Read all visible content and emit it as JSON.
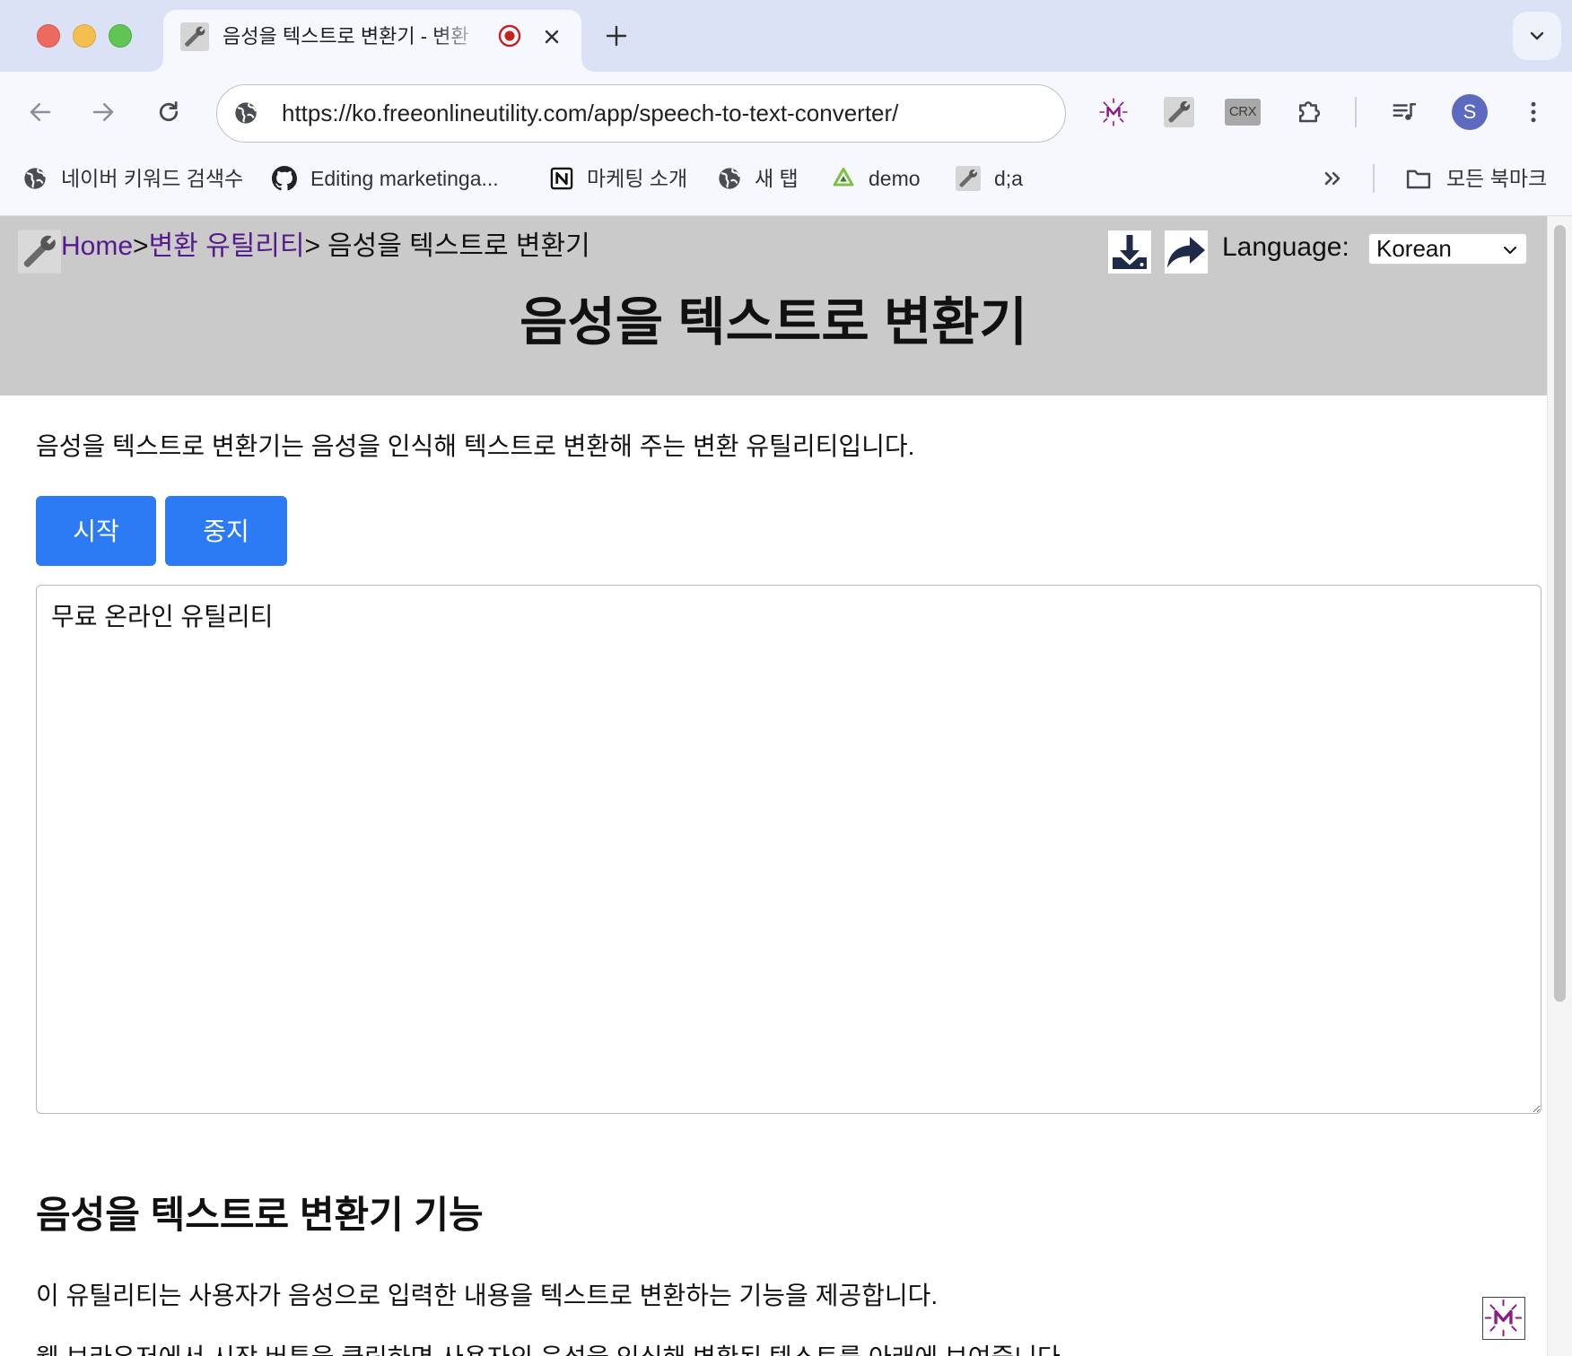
{
  "browser": {
    "tab": {
      "title": "음성을 텍스트로 변환기 - 변환",
      "favicon": "wrench-icon",
      "status_icon": "recording-icon"
    },
    "address_bar": {
      "url": "https://ko.freeonlineutility.com/app/speech-to-text-converter/",
      "site_icon": "globe-icon"
    },
    "extensions": [
      {
        "icon": "m-extension-icon",
        "logo_letter": "M"
      },
      {
        "icon": "wrench-extension-icon"
      },
      {
        "icon": "crx-extension-icon",
        "label": "CRX"
      },
      {
        "icon": "puzzle-icon"
      },
      {
        "icon": "media-control-icon"
      }
    ],
    "profile": {
      "initial": "S",
      "color": "#5c6bc0"
    },
    "bookmarks": [
      {
        "label": "네이버 키워드 검색수",
        "icon": "globe-icon"
      },
      {
        "label": "Editing marketinga...",
        "icon": "github-icon"
      },
      {
        "label": "마케팅 소개",
        "icon": "notion-icon"
      },
      {
        "label": "새 탭",
        "icon": "globe-icon"
      },
      {
        "label": "demo",
        "icon": "demo-icon"
      },
      {
        "label": "d;a",
        "icon": "wrench-icon"
      }
    ],
    "all_bookmarks": {
      "label": "모든 북마크",
      "icon": "folder-icon"
    }
  },
  "header": {
    "breadcrumb": {
      "home": "Home",
      "separator": ">",
      "category": "변환 유틸리티",
      "current": "음성을 텍스트로 변환기"
    },
    "actions": [
      {
        "icon": "download-icon"
      },
      {
        "icon": "share-icon"
      }
    ],
    "language": {
      "label": "Language:",
      "selected": "Korean"
    },
    "title": "음성을 텍스트로 변환기"
  },
  "main": {
    "description": "음성을 텍스트로 변환기는 음성을 인식해 텍스트로 변환해 주는 변환 유틸리티입니다.",
    "buttons": {
      "start": "시작",
      "stop": "중지"
    },
    "transcript": "무료 온라인 유틸리티",
    "features": {
      "heading": "음성을 텍스트로 변환기 기능",
      "paragraphs": [
        "이 유틸리티는 사용자가 음성으로 입력한 내용을 텍스트로 변환하는 기능을 제공합니다.",
        "웹 브라우저에서 시작 버튼을 클릭하면 사용자의 음성을 인식해 변환된 텍스트를 아래에 보여줍니다."
      ]
    }
  },
  "floating_widget": {
    "icon": "m-widget-icon",
    "logo_letter": "M"
  },
  "colors": {
    "tabstrip": "#dbe2f5",
    "toolbar": "#f6f8fe",
    "header_bg": "#cacaca",
    "link": "#551a8b",
    "primary_button": "#2d7bf4",
    "icon_navy": "#1e2a47",
    "extension_purple": "#8b1d8b"
  }
}
